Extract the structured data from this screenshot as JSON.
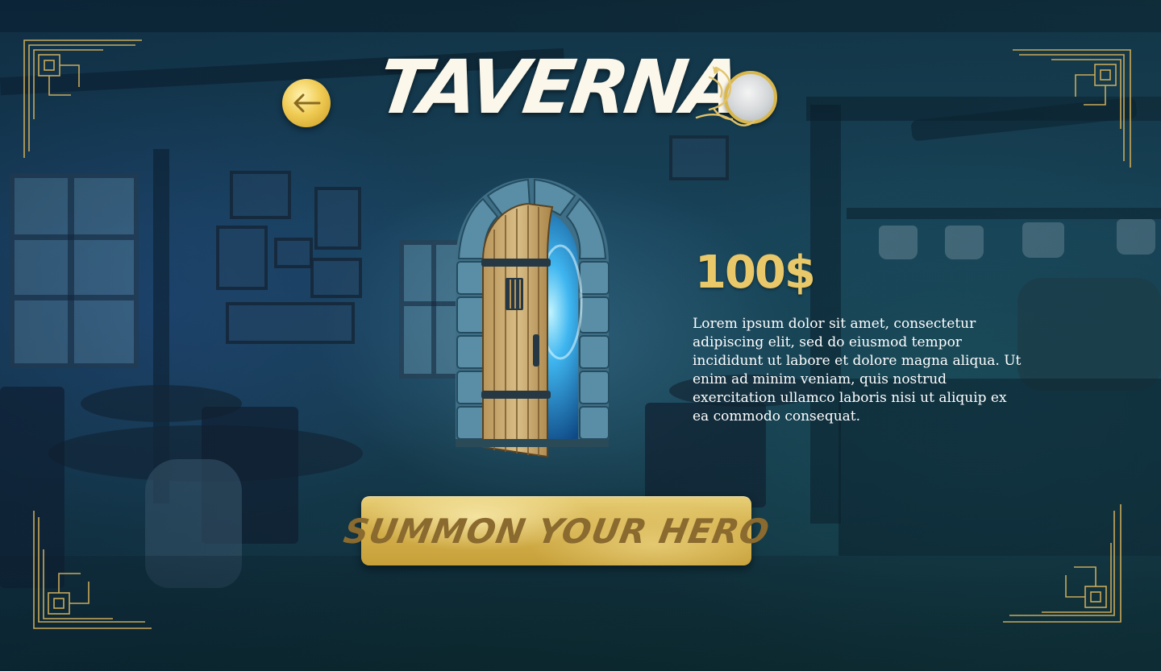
{
  "header": {
    "title": "TAVERNA",
    "back_icon": "arrow-left-icon",
    "emblem_icon": "dragon-emblem-icon"
  },
  "offer": {
    "image": "portal-door-icon",
    "price": "100$",
    "description": "Lorem ipsum dolor sit amet, consectetur adipiscing elit, sed do eiusmod tempor incididunt ut labore et dolore magna aliqua. Ut enim ad minim veniam, quis nostrud exercitation ullamco laboris nisi ut aliquip ex ea commodo consequat."
  },
  "actions": {
    "summon_label": "SUMMON YOUR HERO"
  },
  "colors": {
    "gold": "#e9c86a",
    "title": "#fbf7ea",
    "background": "#163c4e",
    "button": "#d4b04c"
  }
}
